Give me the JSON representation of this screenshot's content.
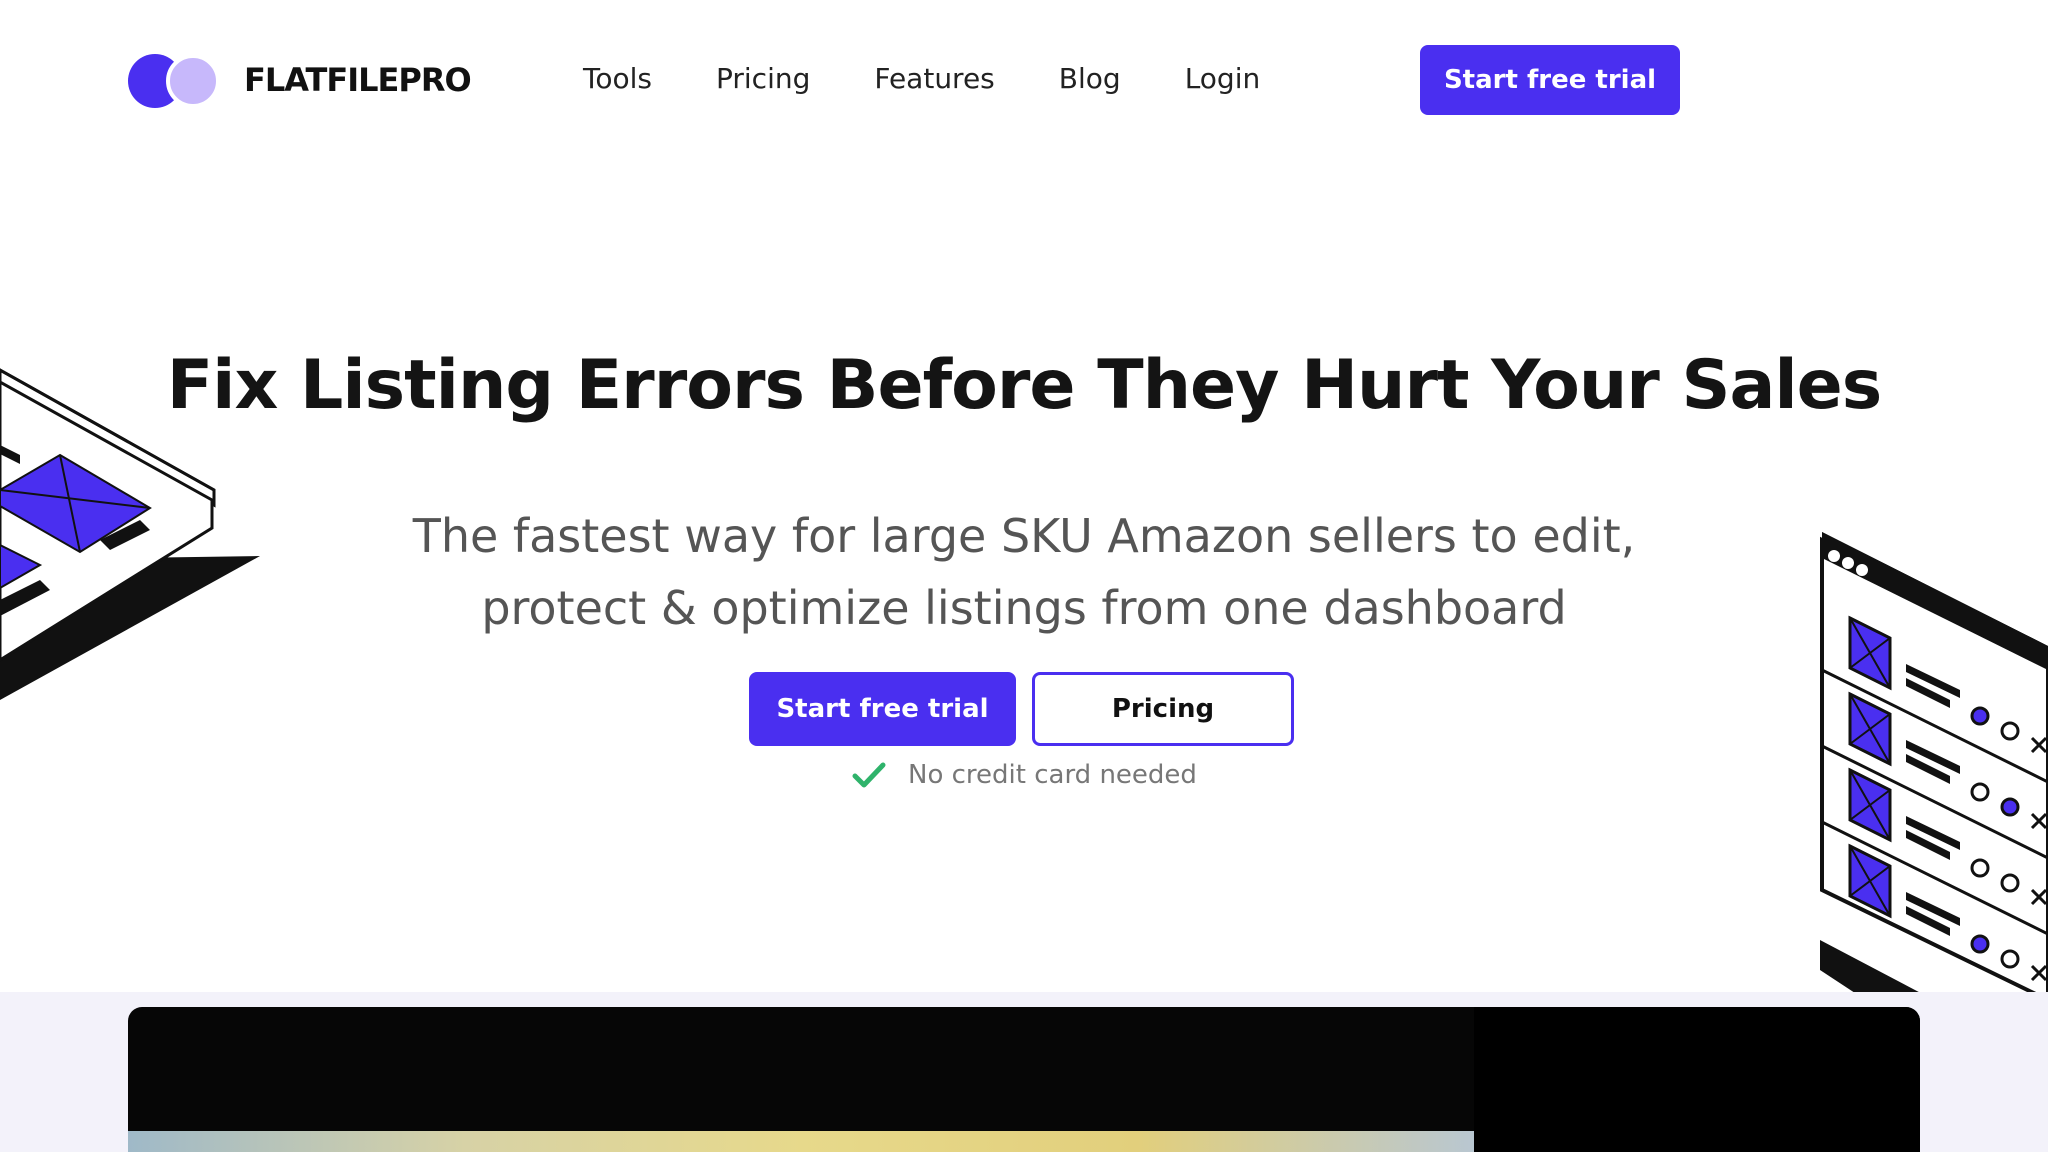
{
  "header": {
    "logo_text": "FLATFILEPRO",
    "nav": [
      "Tools",
      "Pricing",
      "Features",
      "Blog",
      "Login"
    ],
    "cta_label": "Start free trial"
  },
  "hero": {
    "headline": "Fix Listing Errors Before They Hurt Your Sales",
    "subhead_line1": "The fastest way for large SKU Amazon sellers to edit,",
    "subhead_line2": "protect & optimize listings from one dashboard",
    "primary_label": "Start free trial",
    "secondary_label": "Pricing",
    "note": "No credit card needed"
  },
  "colors": {
    "brand": "#4a2ff0",
    "brand_light": "#c7b8fb",
    "check": "#2fb36b",
    "text_dark": "#141414",
    "text_muted": "#555555"
  },
  "icons": {
    "logo_mark": "two-overlapping-circles",
    "note_icon": "check-icon"
  }
}
